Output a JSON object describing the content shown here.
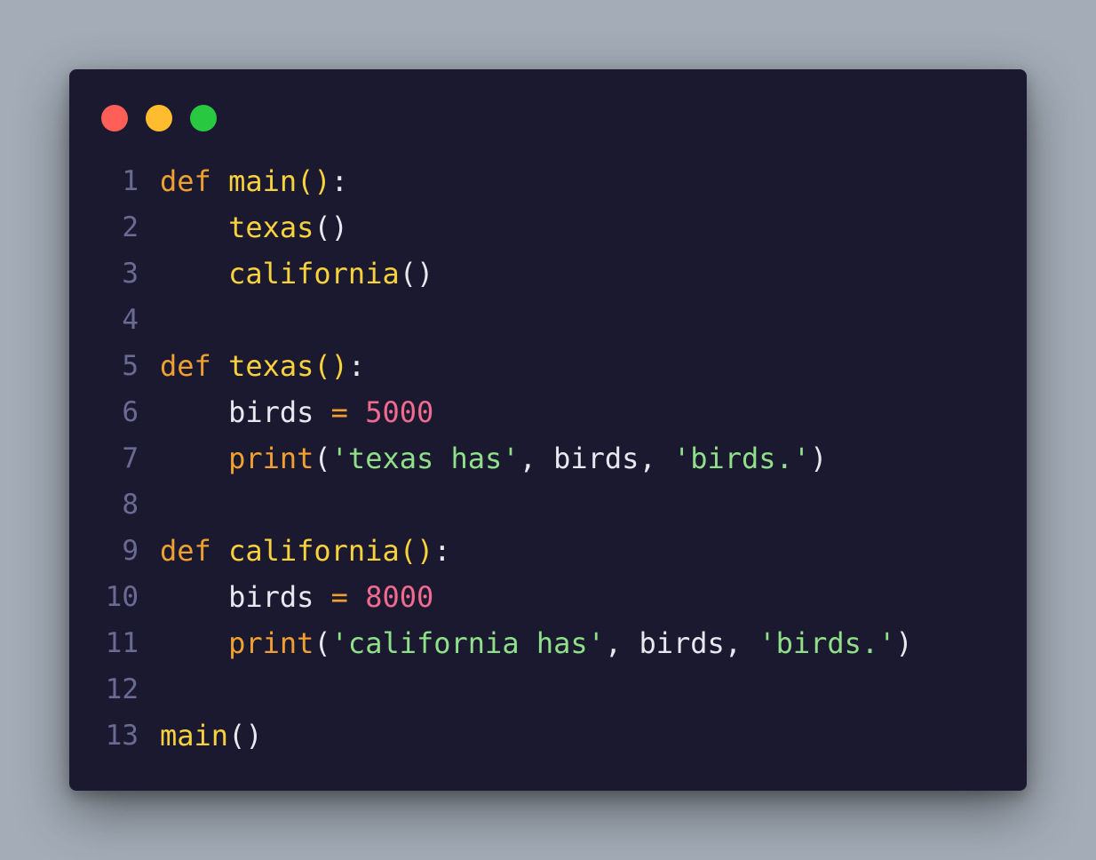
{
  "window": {
    "dots": [
      {
        "name": "close-dot",
        "color": "#ff5f57"
      },
      {
        "name": "minimize-dot",
        "color": "#febc2e"
      },
      {
        "name": "maximize-dot",
        "color": "#28c840"
      }
    ]
  },
  "code": {
    "language": "python",
    "lines": [
      {
        "num": "1",
        "tokens": [
          {
            "t": "def",
            "k": "keyword"
          },
          {
            "t": " ",
            "k": "ident"
          },
          {
            "t": "main",
            "k": "func"
          },
          {
            "t": "()",
            "k": "paren-y"
          },
          {
            "t": ":",
            "k": "punct"
          }
        ]
      },
      {
        "num": "2",
        "tokens": [
          {
            "t": "    ",
            "k": "ident"
          },
          {
            "t": "texas",
            "k": "func"
          },
          {
            "t": "()",
            "k": "paren"
          }
        ]
      },
      {
        "num": "3",
        "tokens": [
          {
            "t": "    ",
            "k": "ident"
          },
          {
            "t": "california",
            "k": "func"
          },
          {
            "t": "()",
            "k": "paren"
          }
        ]
      },
      {
        "num": "4",
        "tokens": []
      },
      {
        "num": "5",
        "tokens": [
          {
            "t": "def",
            "k": "keyword"
          },
          {
            "t": " ",
            "k": "ident"
          },
          {
            "t": "texas",
            "k": "func"
          },
          {
            "t": "()",
            "k": "paren-y"
          },
          {
            "t": ":",
            "k": "punct"
          }
        ]
      },
      {
        "num": "6",
        "tokens": [
          {
            "t": "    ",
            "k": "ident"
          },
          {
            "t": "birds",
            "k": "ident"
          },
          {
            "t": " ",
            "k": "ident"
          },
          {
            "t": "=",
            "k": "op"
          },
          {
            "t": " ",
            "k": "ident"
          },
          {
            "t": "5000",
            "k": "number"
          }
        ]
      },
      {
        "num": "7",
        "tokens": [
          {
            "t": "    ",
            "k": "ident"
          },
          {
            "t": "print",
            "k": "builtin"
          },
          {
            "t": "(",
            "k": "paren"
          },
          {
            "t": "'texas has'",
            "k": "string"
          },
          {
            "t": ", ",
            "k": "punct"
          },
          {
            "t": "birds",
            "k": "ident"
          },
          {
            "t": ", ",
            "k": "punct"
          },
          {
            "t": "'birds.'",
            "k": "string"
          },
          {
            "t": ")",
            "k": "paren"
          }
        ]
      },
      {
        "num": "8",
        "tokens": []
      },
      {
        "num": "9",
        "tokens": [
          {
            "t": "def",
            "k": "keyword"
          },
          {
            "t": " ",
            "k": "ident"
          },
          {
            "t": "california",
            "k": "func"
          },
          {
            "t": "()",
            "k": "paren-y"
          },
          {
            "t": ":",
            "k": "punct"
          }
        ]
      },
      {
        "num": "10",
        "tokens": [
          {
            "t": "    ",
            "k": "ident"
          },
          {
            "t": "birds",
            "k": "ident"
          },
          {
            "t": " ",
            "k": "ident"
          },
          {
            "t": "=",
            "k": "op"
          },
          {
            "t": " ",
            "k": "ident"
          },
          {
            "t": "8000",
            "k": "number"
          }
        ]
      },
      {
        "num": "11",
        "tokens": [
          {
            "t": "    ",
            "k": "ident"
          },
          {
            "t": "print",
            "k": "builtin"
          },
          {
            "t": "(",
            "k": "paren"
          },
          {
            "t": "'california has'",
            "k": "string"
          },
          {
            "t": ", ",
            "k": "punct"
          },
          {
            "t": "birds",
            "k": "ident"
          },
          {
            "t": ", ",
            "k": "punct"
          },
          {
            "t": "'birds.'",
            "k": "string"
          },
          {
            "t": ")",
            "k": "paren"
          }
        ]
      },
      {
        "num": "12",
        "tokens": []
      },
      {
        "num": "13",
        "tokens": [
          {
            "t": "main",
            "k": "func"
          },
          {
            "t": "()",
            "k": "paren"
          }
        ]
      }
    ]
  }
}
